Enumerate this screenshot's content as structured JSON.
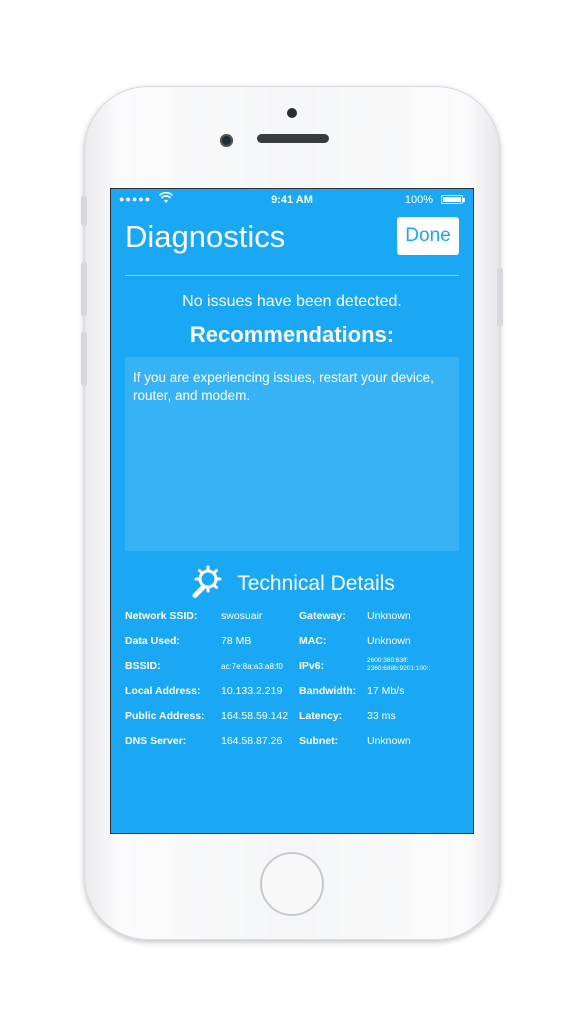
{
  "status_bar": {
    "signal": "●●●●●",
    "wifi_icon": "wifi-icon",
    "time": "9:41 AM",
    "battery": "100%"
  },
  "header": {
    "title": "Diagnostics",
    "done_label": "Done"
  },
  "message": "No issues have been detected.",
  "recommendations": {
    "title": "Recommendations:",
    "text": "If you are experiencing issues, restart your device, router, and modem."
  },
  "technical": {
    "title": "Technical Details",
    "icon": "wrench-gear-icon",
    "rows": [
      {
        "k1": "Network SSID:",
        "v1": "swosuair",
        "k2": "Gateway:",
        "v2": "Unknown"
      },
      {
        "k1": "Data Used:",
        "v1": "78 MB",
        "k2": "MAC:",
        "v2": "Unknown"
      },
      {
        "k1": "BSSID:",
        "v1": "ac:7e:8a:a3:a8:f0",
        "k2": "IPv6:",
        "v2_line1": "2600:380:63ff:",
        "v2_line2": "2360:688b:9201:100::"
      },
      {
        "k1": "Local Address:",
        "v1": "10.133.2.219",
        "k2": "Bandwidth:",
        "v2": "17 Mb/s"
      },
      {
        "k1": "Public Address:",
        "v1": "164.58.59.142",
        "k2": "Latency:",
        "v2": "33 ms"
      },
      {
        "k1": "DNS Server:",
        "v1": "164.58.87.26",
        "k2": "Subnet:",
        "v2": "Unknown"
      }
    ]
  },
  "colors": {
    "screen_bg": "#1aa8f4",
    "accent": "#ffffff"
  }
}
